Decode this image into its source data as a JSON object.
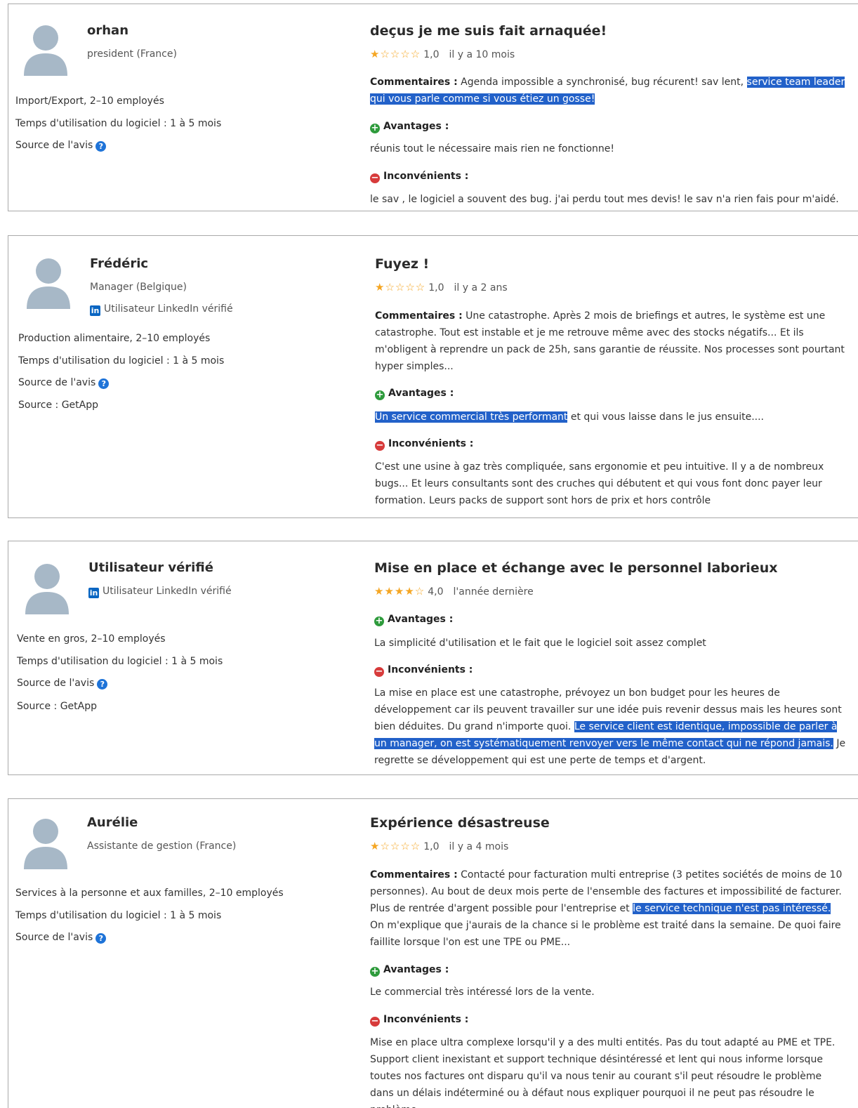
{
  "reviews": [
    {
      "name": "orhan",
      "role": "president (France)",
      "linkedin": "",
      "industry": "Import/Export, 2–10 employés",
      "usage": "Temps d'utilisation du logiciel : 1 à 5 mois",
      "source_label": "Source de l'avis",
      "source": "",
      "title": "deçus je me suis fait arnaquée!",
      "stars": "★☆☆☆☆",
      "rating": "1,0",
      "ago": "il y a 10 mois",
      "comments_label": "Commentaires :",
      "comments_a": "Agenda impossible a synchronisé, bug récurent! sav lent, ",
      "comments_hl": "service team leader qui vous parle comme si vous étiez un gosse!",
      "comments_b": "",
      "pros_label": "Avantages :",
      "pros_hl": "",
      "pros": "réunis tout le nécessaire mais rien ne fonctionne!",
      "cons_label": "Inconvénients :",
      "cons_a": "le sav , le logiciel a souvent des bug. j'ai perdu tout mes devis! le sav n'a rien fais pour m'aidé.",
      "cons_hl": "",
      "cons_b": ""
    },
    {
      "name": "Frédéric",
      "role": "Manager (Belgique)",
      "linkedin": "Utilisateur LinkedIn vérifié",
      "industry": "Production alimentaire, 2–10 employés",
      "usage": "Temps d'utilisation du logiciel : 1 à 5 mois",
      "source_label": "Source de l'avis",
      "source": "Source : GetApp",
      "title": "Fuyez !",
      "stars": "★☆☆☆☆",
      "rating": "1,0",
      "ago": "il y a 2 ans",
      "comments_label": "Commentaires :",
      "comments_a": "Une catastrophe. Après 2 mois de briefings et autres, le système est une catastrophe. Tout est instable et je me retrouve même avec des stocks négatifs... Et ils m'obligent à reprendre un pack de 25h, sans garantie de réussite. Nos processes sont pourtant hyper simples...",
      "comments_hl": "",
      "comments_b": "",
      "pros_label": "Avantages :",
      "pros_hl": "Un service commercial très performant",
      "pros": " et qui vous laisse dans le jus ensuite....",
      "cons_label": "Inconvénients :",
      "cons_a": "C'est une usine à gaz très compliquée, sans ergonomie et peu intuitive. Il y a de nombreux bugs... Et leurs consultants sont des cruches qui débutent et qui vous font donc payer leur formation. Leurs packs de support sont hors de prix et hors contrôle",
      "cons_hl": "",
      "cons_b": ""
    },
    {
      "name": "Utilisateur vérifié",
      "role": "",
      "linkedin": "Utilisateur LinkedIn vérifié",
      "industry": "Vente en gros, 2–10 employés",
      "usage": "Temps d'utilisation du logiciel : 1 à 5 mois",
      "source_label": "Source de l'avis",
      "source": "Source : GetApp",
      "title": "Mise en place et échange avec le personnel laborieux",
      "stars": "★★★★☆",
      "rating": "4,0",
      "ago": "l'année dernière",
      "comments_label": "",
      "comments_a": "",
      "comments_hl": "",
      "comments_b": "",
      "pros_label": "Avantages :",
      "pros_hl": "",
      "pros": "La simplicité d'utilisation et le fait que le logiciel soit assez complet",
      "cons_label": "Inconvénients :",
      "cons_a": "La mise en place est une catastrophe, prévoyez un bon budget pour les heures de développement car ils peuvent travailler sur une idée puis revenir dessus mais les heures sont bien déduites. Du grand n'importe quoi. ",
      "cons_hl": "Le service client est identique, impossible de parler à un manager, on est systématiquement renvoyer vers le même contact qui ne répond jamais.",
      "cons_b": " Je regrette se développement qui est une perte de temps et d'argent."
    },
    {
      "name": "Aurélie",
      "role": "Assistante de gestion (France)",
      "linkedin": "",
      "industry": "Services à la personne et aux familles, 2–10 employés",
      "usage": "Temps d'utilisation du logiciel : 1 à 5 mois",
      "source_label": "Source de l'avis",
      "source": "",
      "title": "Expérience désastreuse",
      "stars": "★☆☆☆☆",
      "rating": "1,0",
      "ago": "il y a 4 mois",
      "comments_label": "Commentaires :",
      "comments_a": "Contacté pour facturation multi entreprise (3 petites sociétés de moins de 10 personnes). Au bout de deux mois perte de l'ensemble des factures et impossibilité de facturer. Plus de rentrée d'argent possible pour l'entreprise et ",
      "comments_hl": "le service technique n'est pas intéressé.",
      "comments_b": " On m'explique que j'aurais de la chance si le problème est traité dans la semaine. De quoi faire faillite lorsque l'on est une TPE ou PME...",
      "pros_label": "Avantages :",
      "pros_hl": "",
      "pros": "Le commercial très intéressé lors de la vente.",
      "cons_label": "Inconvénients :",
      "cons_a": "Mise en place ultra complexe lorsqu'il y a des multi entités. Pas du tout adapté au PME et TPE. Support client inexistant et support technique désintéressé et lent qui nous informe lorsque toutes nos factures ont disparu qu'il va nous tenir au courant s'il peut résoudre le problème dans un délais indéterminé ou à défaut nous expliquer pourquoi il ne peut pas résoudre le problème...",
      "cons_hl": "",
      "cons_b": ""
    }
  ]
}
